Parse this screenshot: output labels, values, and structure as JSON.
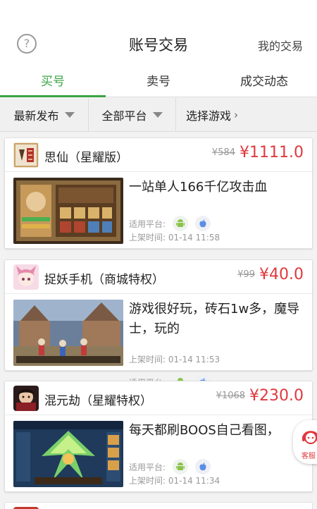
{
  "header": {
    "help_symbol": "?",
    "title": "账号交易",
    "my_trades_label": "我的交易"
  },
  "tabs": [
    {
      "label": "买号",
      "active": true
    },
    {
      "label": "卖号",
      "active": false
    },
    {
      "label": "成交动态",
      "active": false
    }
  ],
  "filters": {
    "sort_label": "最新发布",
    "platform_label": "全部平台",
    "game_label": "选择游戏",
    "game_chevron": "›"
  },
  "listings": [
    {
      "game_name": "思仙（星耀版）",
      "old_price": "¥584",
      "price": "¥1111.0",
      "description": "一站单人166千亿攻击血",
      "platform_label": "适用平台:",
      "platforms": [
        "android-icon",
        "apple-icon"
      ],
      "time": "上架时间: 01-14 11:58"
    },
    {
      "game_name": "捉妖手机（商城特权）",
      "old_price": "¥99",
      "price": "¥40.0",
      "description": "游戏很好玩，砖石1w多，魔导士，玩的",
      "platform_label": "适用平台:",
      "platforms": [
        "android-icon",
        "apple-icon"
      ],
      "time": "上架时间: 01-14 11:53"
    },
    {
      "game_name": "混元劫（星耀特权）",
      "old_price": "¥1068",
      "price": "¥230.0",
      "description": "每天都刷BOOS自己看图，",
      "platform_label": "适用平台:",
      "platforms": [
        "android-icon",
        "apple-icon"
      ],
      "time": "上架时间: 01-14 11:34"
    }
  ],
  "customer_service": {
    "label": "客服"
  },
  "colors": {
    "accent_green": "#3aa444",
    "price_red": "#e0393e",
    "android_green": "#8bc34a",
    "apple_blue": "#5b8fe6"
  }
}
